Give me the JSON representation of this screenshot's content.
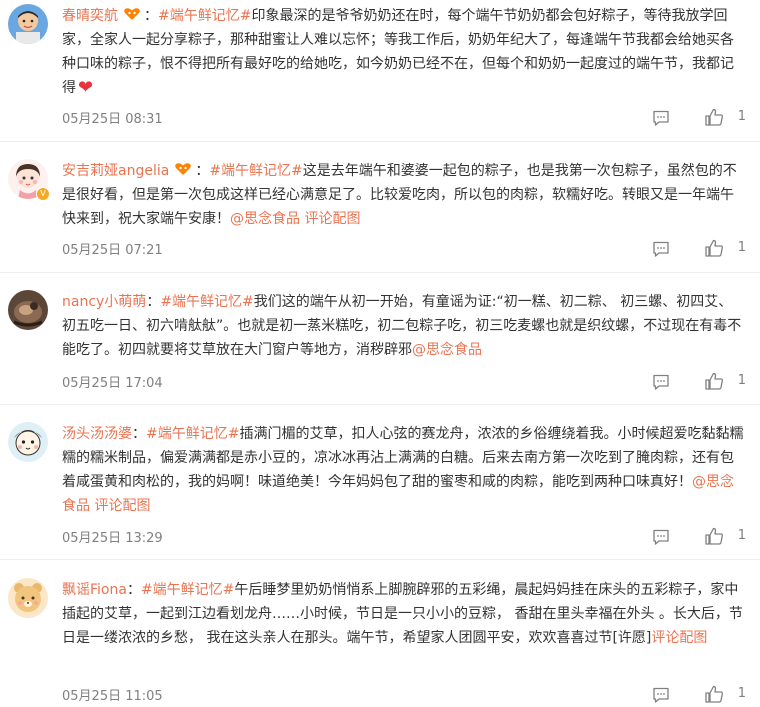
{
  "comments": [
    {
      "user": "春晴奕航",
      "colon": "：",
      "segments": [
        {
          "type": "hashtag",
          "text": "#端午鲜记忆#"
        },
        {
          "type": "text",
          "text": "印象最深的是爷爷奶奶还在时，每个端午节奶奶都会包好粽子，等待我放学回家，全家人一起分享粽子，那种甜蜜让人难以忘怀；等我工作后，奶奶年纪大了，每逢端午节我都会给她买各种口味的粽子，恨不得把所有最好吃的给她吃，如今奶奶已经不在，但每个和奶奶一起度过的端午节，我都记得"
        }
      ],
      "emoji": "❤",
      "time": "05月25日 08:31",
      "likes": "1"
    },
    {
      "user": "安吉莉娅angelia",
      "colon": "：",
      "segments": [
        {
          "type": "hashtag",
          "text": "#端午鲜记忆#"
        },
        {
          "type": "text",
          "text": "这是去年端午和婆婆一起包的粽子，也是我第一次包粽子，虽然包的不是很好看，但是第一次包成这样已经心满意足了。比较爱吃肉，所以包的肉粽，软糯好吃。转眼又是一年端午快来到，祝大家端午安康！"
        },
        {
          "type": "link",
          "text": "@思念食品"
        },
        {
          "type": "text",
          "text": " "
        },
        {
          "type": "link",
          "text": "评论配图"
        }
      ],
      "time": "05月25日 07:21",
      "likes": "1"
    },
    {
      "user": "nancy小萌萌",
      "colon": "：",
      "segments": [
        {
          "type": "hashtag",
          "text": "#端午鲜记忆#"
        },
        {
          "type": "text",
          "text": "我们这的端午从初一开始，有童谣为证:“初一糕、初二粽、 初三螺、初四艾、初五吃一日、初六啃舦舦”。也就是初一蒸米糕吃，初二包粽子吃，初三吃麦螺也就是织纹螺，不过现在有毒不能吃了。初四就要将艾草放在大门窗户等地方，消秽辟邪"
        },
        {
          "type": "link",
          "text": "@思念食品"
        }
      ],
      "time": "05月25日 17:04",
      "likes": "1"
    },
    {
      "user": "汤头汤汤婆",
      "colon": "：",
      "segments": [
        {
          "type": "hashtag",
          "text": "#端午鲜记忆#"
        },
        {
          "type": "text",
          "text": "插满门楣的艾草，扣人心弦的赛龙舟，浓浓的乡俗缠绕着我。小时候超爱吃黏黏糯糯的糯米制品，偏爱满满都是赤小豆的，凉冰冰再沾上满满的白糖。后来去南方第一次吃到了腌肉粽，还有包着咸蛋黄和肉松的，我的妈啊！味道绝美！今年妈妈包了甜的蜜枣和咸的肉粽，能吃到两种口味真好！"
        },
        {
          "type": "link",
          "text": "@思念食品"
        },
        {
          "type": "text",
          "text": " "
        },
        {
          "type": "link",
          "text": "评论配图"
        }
      ],
      "time": "05月25日 13:29",
      "likes": "1"
    },
    {
      "user": "飘谣Fiona",
      "colon": "：",
      "segments": [
        {
          "type": "hashtag",
          "text": "#端午鲜记忆#"
        },
        {
          "type": "text",
          "text": "午后睡梦里奶奶悄悄系上脚腕辟邪的五彩绳，晨起妈妈挂在床头的五彩粽子，家中插起的艾草，一起到江边看划龙舟……小时候，节日是一只小小的豆粽， 香甜在里头幸福在外头 。长大后，节日是一缕浓浓的乡愁， 我在这头亲人在那头。端午节，希望家人团圆平安，欢欢喜喜过节[许愿]"
        },
        {
          "type": "link",
          "text": "评论配图"
        }
      ],
      "time": "05月25日 11:05",
      "likes": "1"
    }
  ],
  "colors": {
    "accent": "#eb7350",
    "text": "#333333",
    "meta": "#808080",
    "divider": "#eeeeee",
    "heart": "#e8323c",
    "fan_badge": "#ff8200"
  },
  "icons": {
    "comment": "comment-icon",
    "like": "thumbs-up-icon",
    "fan_badge": "fan-badge-icon",
    "verified": "verified-badge-icon"
  }
}
